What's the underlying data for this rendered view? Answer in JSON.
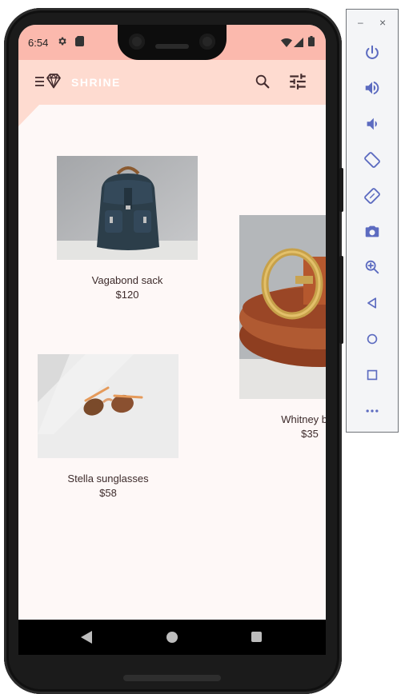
{
  "status_bar": {
    "time": "6:54"
  },
  "app_bar": {
    "title": "SHRINE"
  },
  "products": [
    {
      "name": "Vagabond sack",
      "price": "$120"
    },
    {
      "name": "Whitney belt",
      "price": "$35"
    },
    {
      "name": "Stella sunglasses",
      "price": "$58"
    }
  ],
  "emulator": {
    "minimize": "–",
    "close": "×",
    "controls": [
      "power-icon",
      "volume-up-icon",
      "volume-down-icon",
      "rotate-left-icon",
      "rotate-right-icon",
      "camera-icon",
      "zoom-icon",
      "back-icon",
      "home-icon",
      "overview-icon",
      "more-icon"
    ]
  },
  "colors": {
    "status_bar": "#fbb9ad",
    "app_bar": "#fedbd0",
    "surface": "#fef8f7",
    "text": "#3d2b2b",
    "icon": "#442c2e",
    "emulator_icon": "#5c6bc0"
  }
}
